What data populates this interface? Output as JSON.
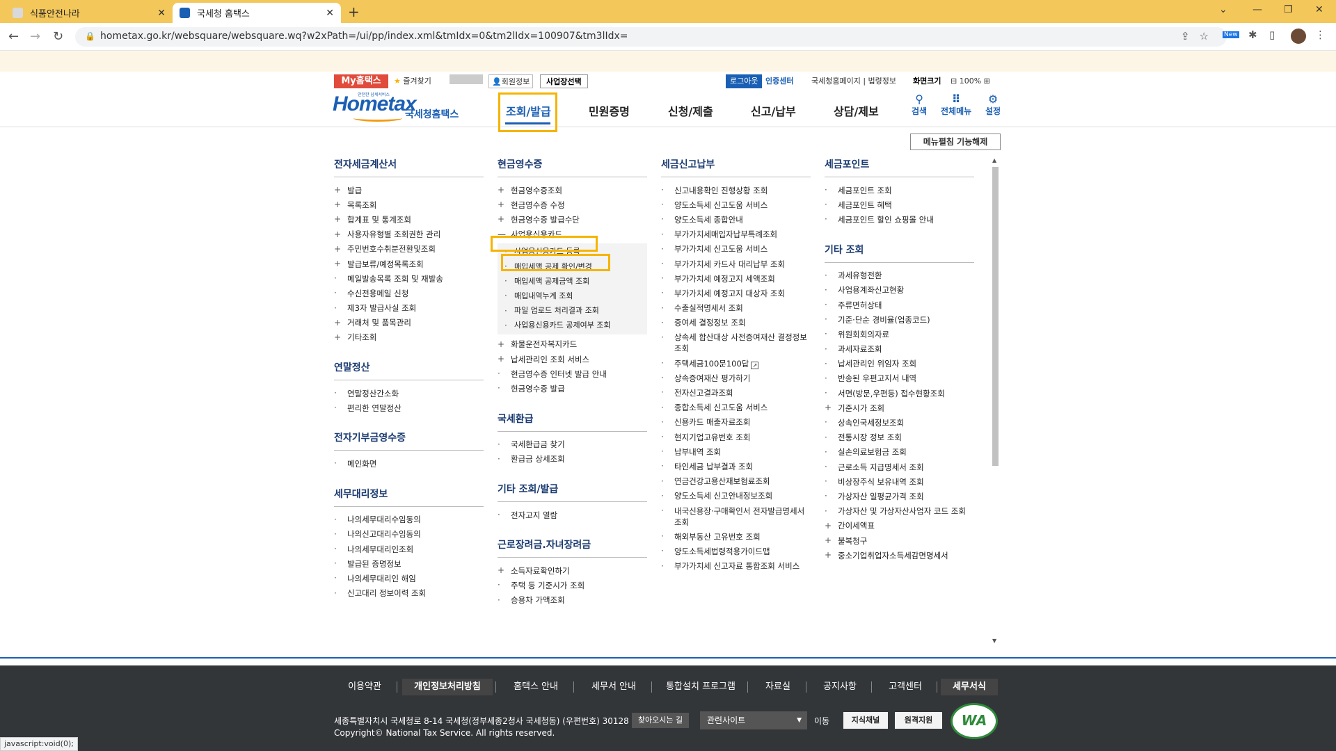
{
  "browser": {
    "tabs": [
      {
        "title": "식품안전나라"
      },
      {
        "title": "국세청 홈택스"
      }
    ],
    "new_tab": "+",
    "url": "hometax.go.kr/websquare/websquare.wq?w2xPath=/ui/pp/index.xml&tmIdx=0&tm2lIdx=100907&tm3lIdx=",
    "new_badge": "New",
    "status": "javascript:void(0);"
  },
  "util": {
    "my": "My홈택스",
    "fav": "즐겨찾기",
    "member": "회원정보",
    "biz": "사업장선택",
    "logout": "로그아웃",
    "cert": "인증센터",
    "links": "국세청홈페이지 | 법령정보",
    "zoom_label": "화면크기",
    "zoom_value": "100%"
  },
  "header": {
    "logo_text": "Hometax",
    "logo_tag": "안전한 납세서비스",
    "brand": "국세청홈택스",
    "gnb": [
      "조회/발급",
      "민원증명",
      "신청/제출",
      "신고/납부",
      "상담/제보"
    ],
    "tools": [
      {
        "label": "검색",
        "icon": "search-icon"
      },
      {
        "label": "전체메뉴",
        "icon": "grid-icon"
      },
      {
        "label": "설정",
        "icon": "gear-icon"
      }
    ]
  },
  "menu_off": "메뉴펼침 기능해제",
  "columns": [
    {
      "groups": [
        {
          "title": "전자세금계산서",
          "items": [
            {
              "t": "발급",
              "m": "+"
            },
            {
              "t": "목록조회",
              "m": "+"
            },
            {
              "t": "합계표 및 통계조회",
              "m": "+"
            },
            {
              "t": "사용자유형별 조회권한 관리",
              "m": "+"
            },
            {
              "t": "주민번호수취분전환및조회",
              "m": "+"
            },
            {
              "t": "발급보류/예정목록조회",
              "m": "+"
            },
            {
              "t": "메일발송목록 조회 및 재발송",
              "m": "·"
            },
            {
              "t": "수신전용메일 신청",
              "m": "·"
            },
            {
              "t": "제3자 발급사실 조회",
              "m": "·"
            },
            {
              "t": "거래처 및 품목관리",
              "m": "+"
            },
            {
              "t": "기타조회",
              "m": "+"
            }
          ]
        },
        {
          "title": "연말정산",
          "items": [
            {
              "t": "연말정산간소화",
              "m": "·"
            },
            {
              "t": "편리한 연말정산",
              "m": "·"
            }
          ]
        },
        {
          "title": "전자기부금영수증",
          "items": [
            {
              "t": "메인화면",
              "m": "·"
            }
          ]
        },
        {
          "title": "세무대리정보",
          "items": [
            {
              "t": "나의세무대리수임동의",
              "m": "·"
            },
            {
              "t": "나의신고대리수임동의",
              "m": "·"
            },
            {
              "t": "나의세무대리인조회",
              "m": "·"
            },
            {
              "t": "발급된 증명정보",
              "m": "·"
            },
            {
              "t": "나의세무대리인 해임",
              "m": "·"
            },
            {
              "t": "신고대리 정보이력 조회",
              "m": "·"
            }
          ]
        }
      ]
    },
    {
      "groups": [
        {
          "title": "현금영수증",
          "items": [
            {
              "t": "현금영수증조회",
              "m": "+"
            },
            {
              "t": "현금영수증 수정",
              "m": "+"
            },
            {
              "t": "현금영수증 발급수단",
              "m": "+"
            },
            {
              "t": "사업용신용카드",
              "m": "—"
            }
          ],
          "sub": [
            "사업용신용카드 등록",
            "매입세액 공제 확인/변경",
            "매입세액 공제금액 조회",
            "매입내역누계 조회",
            "파일 업로드 처리결과 조회",
            "사업용신용카드 공제여부 조회"
          ],
          "items_after": [
            {
              "t": "화물운전자복지카드",
              "m": "+"
            },
            {
              "t": "납세관리인 조회 서비스",
              "m": "+"
            },
            {
              "t": "현금영수증 인터넷 발급 안내",
              "m": "·"
            },
            {
              "t": "현금영수증 발급",
              "m": "·"
            }
          ]
        },
        {
          "title": "국세환급",
          "items": [
            {
              "t": "국세환급금 찾기",
              "m": "·"
            },
            {
              "t": "환급금 상세조회",
              "m": "·"
            }
          ]
        },
        {
          "title": "기타 조회/발급",
          "items": [
            {
              "t": "전자고지 열람",
              "m": "·"
            }
          ]
        },
        {
          "title": "근로장려금.자녀장려금",
          "items": [
            {
              "t": "소득자료확인하기",
              "m": "+"
            },
            {
              "t": "주택 등 기준시가 조회",
              "m": "·"
            },
            {
              "t": "승용차 가액조회",
              "m": "·"
            }
          ]
        }
      ]
    },
    {
      "groups": [
        {
          "title": "세금신고납부",
          "items": [
            {
              "t": "신고내용확인 진행상황 조회",
              "m": "·"
            },
            {
              "t": "양도소득세 신고도움 서비스",
              "m": "·"
            },
            {
              "t": "양도소득세 종합안내",
              "m": "·"
            },
            {
              "t": "부가가치세매입자납부특례조회",
              "m": "·"
            },
            {
              "t": "부가가치세 신고도움 서비스",
              "m": "·"
            },
            {
              "t": "부가가치세 카드사 대리납부 조회",
              "m": "·"
            },
            {
              "t": "부가가치세 예정고지 세액조회",
              "m": "·"
            },
            {
              "t": "부가가치세 예정고지 대상자 조회",
              "m": "·"
            },
            {
              "t": "수출실적명세서 조회",
              "m": "·"
            },
            {
              "t": "증여세 결정정보 조회",
              "m": "·"
            },
            {
              "t": "상속세 합산대상 사전증여재산 결정정보 조회",
              "m": "·"
            },
            {
              "t": "주택세금100문100답",
              "m": "·",
              "ext": true
            },
            {
              "t": "상속증여재산 평가하기",
              "m": "·"
            },
            {
              "t": "전자신고결과조회",
              "m": "·"
            },
            {
              "t": "종합소득세 신고도움 서비스",
              "m": "·"
            },
            {
              "t": "신용카드 매출자료조회",
              "m": "·"
            },
            {
              "t": "현지기업고유번호 조회",
              "m": "·"
            },
            {
              "t": "납부내역 조회",
              "m": "·"
            },
            {
              "t": "타인세금 납부결과 조회",
              "m": "·"
            },
            {
              "t": "연금건강고용산재보험료조회",
              "m": "·"
            },
            {
              "t": "양도소득세 신고안내정보조회",
              "m": "·"
            },
            {
              "t": "내국신용장·구매확인서 전자발급명세서 조회",
              "m": "·"
            },
            {
              "t": "해외부동산 고유번호 조회",
              "m": "·"
            },
            {
              "t": "양도소득세법령적용가이드맵",
              "m": "·"
            },
            {
              "t": "부가가치세 신고자료 통합조회 서비스",
              "m": "·"
            }
          ]
        }
      ]
    },
    {
      "groups": [
        {
          "title": "세금포인트",
          "items": [
            {
              "t": "세금포인트 조회",
              "m": "·"
            },
            {
              "t": "세금포인트 혜택",
              "m": "·"
            },
            {
              "t": "세금포인트 할인 쇼핑몰 안내",
              "m": "·"
            }
          ]
        },
        {
          "title": "기타 조회",
          "items": [
            {
              "t": "과세유형전환",
              "m": "·"
            },
            {
              "t": "사업용계좌신고현황",
              "m": "·"
            },
            {
              "t": "주류면허상태",
              "m": "·"
            },
            {
              "t": "기준·단순 경비율(업종코드)",
              "m": "·"
            },
            {
              "t": "위원회회의자료",
              "m": "·"
            },
            {
              "t": "과세자료조회",
              "m": "·"
            },
            {
              "t": "납세관리인 위임자 조회",
              "m": "·"
            },
            {
              "t": "반송된 우편고지서 내역",
              "m": "·"
            },
            {
              "t": "서면(방문,우편등) 접수현황조회",
              "m": "·"
            },
            {
              "t": "기준시가 조회",
              "m": "+"
            },
            {
              "t": "상속인국세정보조회",
              "m": "·"
            },
            {
              "t": "전통시장 정보 조회",
              "m": "·"
            },
            {
              "t": "실손의료보험금 조회",
              "m": "·"
            },
            {
              "t": "근로소득 지급명세서 조회",
              "m": "·"
            },
            {
              "t": "비상장주식 보유내역 조회",
              "m": "·"
            },
            {
              "t": "가상자산 일평균가격 조회",
              "m": "·"
            },
            {
              "t": "가상자산 및 가상자산사업자 코드 조회",
              "m": "·"
            },
            {
              "t": "간이세액표",
              "m": "+"
            },
            {
              "t": "불복청구",
              "m": "+"
            },
            {
              "t": "중소기업취업자소득세감면명세서",
              "m": "+"
            }
          ]
        }
      ]
    }
  ],
  "footer": {
    "nav": [
      "이용약관",
      "개인정보처리방침",
      "홈택스 안내",
      "세무서 안내",
      "통합설치 프로그램",
      "자료실",
      "공지사항",
      "고객센터",
      "세무서식"
    ],
    "address": "세종특별자치시 국세청로 8-14 국세청(정부세종2청사 국세청동) (우편번호) 30128",
    "find": "찾아오시는 길",
    "copyright": "Copyright© National Tax Service. All rights reserved.",
    "related": "관련사이트",
    "go": "이동",
    "btn1": "지식채널",
    "btn2": "원격지원",
    "wa": "WA"
  }
}
